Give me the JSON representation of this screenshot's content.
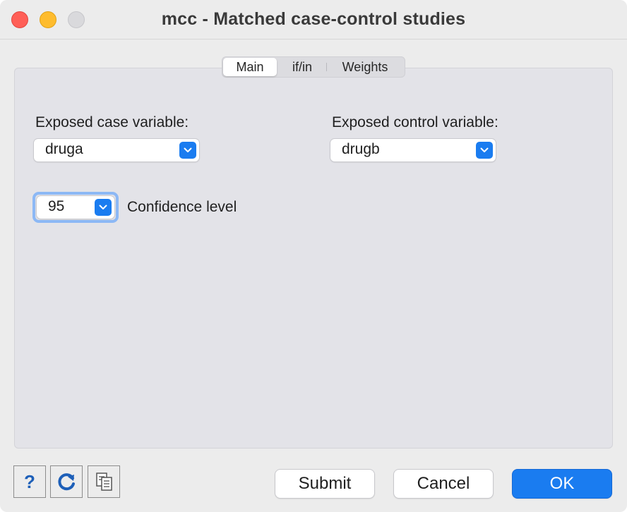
{
  "window": {
    "title": "mcc - Matched case-control studies"
  },
  "tabs": [
    {
      "label": "Main",
      "selected": true
    },
    {
      "label": "if/in",
      "selected": false
    },
    {
      "label": "Weights",
      "selected": false
    }
  ],
  "main": {
    "case_label": "Exposed case variable:",
    "case_value": "druga",
    "control_label": "Exposed control variable:",
    "control_value": "drugb",
    "confidence_value": "95",
    "confidence_label": "Confidence level"
  },
  "footer": {
    "help_label": "?",
    "submit_label": "Submit",
    "cancel_label": "Cancel",
    "ok_label": "OK"
  },
  "colors": {
    "accent": "#1a7cf0",
    "close": "#ff5f57",
    "minimize": "#febc2e",
    "zoom_disabled": "#d9d9dc"
  },
  "icons": [
    "close-icon",
    "minimize-icon",
    "zoom-icon",
    "chevron-down-icon",
    "help-icon",
    "reset-icon",
    "copy-command-icon"
  ]
}
